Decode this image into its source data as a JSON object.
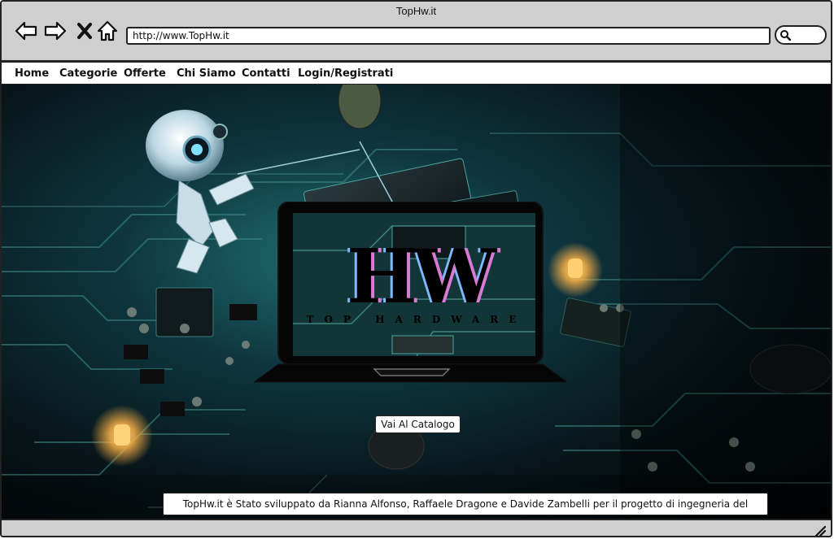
{
  "window": {
    "title": "TopHw.it"
  },
  "toolbar": {
    "url": "http://www.TopHw.it",
    "icons": [
      "back-icon",
      "forward-icon",
      "close-icon",
      "home-icon",
      "search-icon"
    ]
  },
  "menu": {
    "items": [
      {
        "label": "Home"
      },
      {
        "label": "Categorie"
      },
      {
        "label": "Offerte"
      },
      {
        "label": "Chi Siamo"
      },
      {
        "label": "Contatti"
      },
      {
        "label": "Login/Registrati"
      }
    ]
  },
  "hero": {
    "logo_text": "HW",
    "logo_tagline": "TOP HARDWARE",
    "catalog_button": "Vai Al Catalogo",
    "credits": "TopHw.it è Stato sviluppato da Rianna Alfonso, Raffaele Dragone e Davide Zambelli per il progetto di ingegneria del software"
  },
  "colors": {
    "chrome": "#cfcfcf",
    "background_dark": "#071418",
    "circuit_teal": "#1f6f70",
    "led_glow": "#ffb347"
  }
}
